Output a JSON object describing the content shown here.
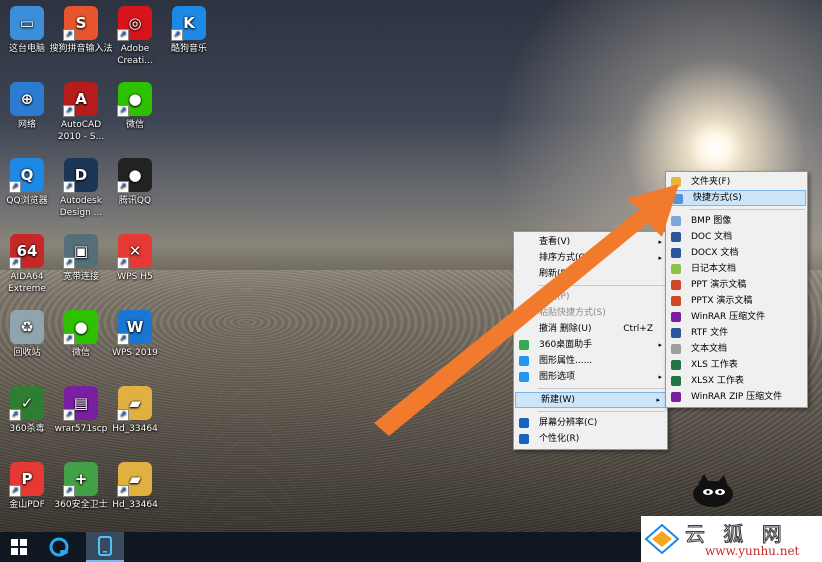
{
  "desktop_icons": [
    {
      "label": "这台电脑",
      "icon": "computer-icon",
      "color": "#3b8fd9",
      "glyph": "▭"
    },
    {
      "label": "搜狗拼音输入法",
      "icon": "sogou-icon",
      "color": "#e8542c",
      "glyph": "S"
    },
    {
      "label": "Adobe Creati...",
      "icon": "adobe-cc-icon",
      "color": "#d7141a",
      "glyph": "◎"
    },
    {
      "label": "酷狗音乐",
      "icon": "kugou-icon",
      "color": "#1e88e5",
      "glyph": "K"
    },
    {
      "label": "网络",
      "icon": "network-icon",
      "color": "#2c7bd1",
      "glyph": "⊕"
    },
    {
      "label": "AutoCAD 2010 - S...",
      "icon": "autocad-icon",
      "color": "#b71c1c",
      "glyph": "A"
    },
    {
      "label": "微信",
      "icon": "wechat-icon",
      "color": "#2dc100",
      "glyph": "●"
    },
    {
      "label": "QQ浏览器",
      "icon": "qq-browser-icon",
      "color": "#1e88e5",
      "glyph": "Q"
    },
    {
      "label": "Autodesk Design ...",
      "icon": "autodesk-icon",
      "color": "#1d3557",
      "glyph": "D"
    },
    {
      "label": "腾讯QQ",
      "icon": "qq-icon",
      "color": "#222222",
      "glyph": "●"
    },
    {
      "label": "AIDA64 Extreme",
      "icon": "aida64-icon",
      "color": "#c62828",
      "glyph": "64"
    },
    {
      "label": "宽带连接",
      "icon": "broadband-icon",
      "color": "#546e7a",
      "glyph": "▣"
    },
    {
      "label": "WPS H5",
      "icon": "wps-h5-icon",
      "color": "#e53935",
      "glyph": "✕"
    },
    {
      "label": "回收站",
      "icon": "recycle-bin-icon",
      "color": "#90a4ae",
      "glyph": "♻"
    },
    {
      "label": "微信",
      "icon": "wechat-icon",
      "color": "#2dc100",
      "glyph": "●"
    },
    {
      "label": "WPS 2019",
      "icon": "wps-2019-icon",
      "color": "#1976d2",
      "glyph": "W"
    },
    {
      "label": "360杀毒",
      "icon": "360-antivirus-icon",
      "color": "#2e7d32",
      "glyph": "✓"
    },
    {
      "label": "wrar571scp",
      "icon": "winrar-icon",
      "color": "#7b1fa2",
      "glyph": "▤"
    },
    {
      "label": "Hd_33464",
      "icon": "folder-zip-icon",
      "color": "#e0b040",
      "glyph": "▰"
    },
    {
      "label": "金山PDF",
      "icon": "kingsoft-pdf-icon",
      "color": "#e53935",
      "glyph": "P"
    },
    {
      "label": "360安全卫士",
      "icon": "360-security-icon",
      "color": "#43a047",
      "glyph": "+"
    },
    {
      "label": "Hd_33464",
      "icon": "folder-zip-icon",
      "color": "#e0b040",
      "glyph": "▰"
    }
  ],
  "context_menu": {
    "items": [
      {
        "label": "查看(V)",
        "arrow": "▸",
        "icon": ""
      },
      {
        "label": "排序方式(O)",
        "arrow": "▸",
        "icon": ""
      },
      {
        "label": "刷新(E)",
        "arrow": "",
        "icon": ""
      },
      {
        "sep": true
      },
      {
        "label": "粘贴(P)",
        "arrow": "",
        "icon": "",
        "disabled": true
      },
      {
        "label": "粘贴快捷方式(S)",
        "arrow": "",
        "icon": "",
        "disabled": true
      },
      {
        "label": "撤消 删除(U)",
        "shortcut": "Ctrl+Z",
        "arrow": "",
        "icon": ""
      },
      {
        "label": "360桌面助手",
        "arrow": "▸",
        "icon": "#34a853"
      },
      {
        "label": "图形属性......",
        "arrow": "",
        "icon": "#2196f3"
      },
      {
        "label": "图形选项",
        "arrow": "▸",
        "icon": "#2196f3"
      },
      {
        "sep": true
      },
      {
        "label": "新建(W)",
        "arrow": "▸",
        "icon": "",
        "highlight": true
      },
      {
        "sep": true
      },
      {
        "label": "屏幕分辨率(C)",
        "arrow": "",
        "icon": "#1565c0"
      },
      {
        "label": "个性化(R)",
        "arrow": "",
        "icon": "#1565c0"
      }
    ]
  },
  "new_submenu": {
    "items": [
      {
        "label": "文件夹(F)",
        "icon": "#e8b640"
      },
      {
        "label": "快捷方式(S)",
        "icon": "#5b8fd6",
        "highlight": true
      },
      {
        "sep": true
      },
      {
        "label": "BMP 图像",
        "icon": "#7da7d9"
      },
      {
        "label": "DOC 文档",
        "icon": "#2b579a"
      },
      {
        "label": "DOCX 文档",
        "icon": "#2b579a"
      },
      {
        "label": "日记本文档",
        "icon": "#8bc34a"
      },
      {
        "label": "PPT 演示文稿",
        "icon": "#d24726"
      },
      {
        "label": "PPTX 演示文稿",
        "icon": "#d24726"
      },
      {
        "label": "WinRAR 压缩文件",
        "icon": "#7b1fa2"
      },
      {
        "label": "RTF 文件",
        "icon": "#2b579a"
      },
      {
        "label": "文本文档",
        "icon": "#9e9e9e"
      },
      {
        "label": "XLS 工作表",
        "icon": "#217346"
      },
      {
        "label": "XLSX 工作表",
        "icon": "#217346"
      },
      {
        "label": "WinRAR ZIP 压缩文件",
        "icon": "#7b1fa2"
      }
    ]
  },
  "watermark": {
    "text": "www.yunhu.net",
    "brand": "云 狐 网"
  },
  "colors": {
    "arrow": "#f27a2d",
    "taskbar": "#0f1720"
  }
}
